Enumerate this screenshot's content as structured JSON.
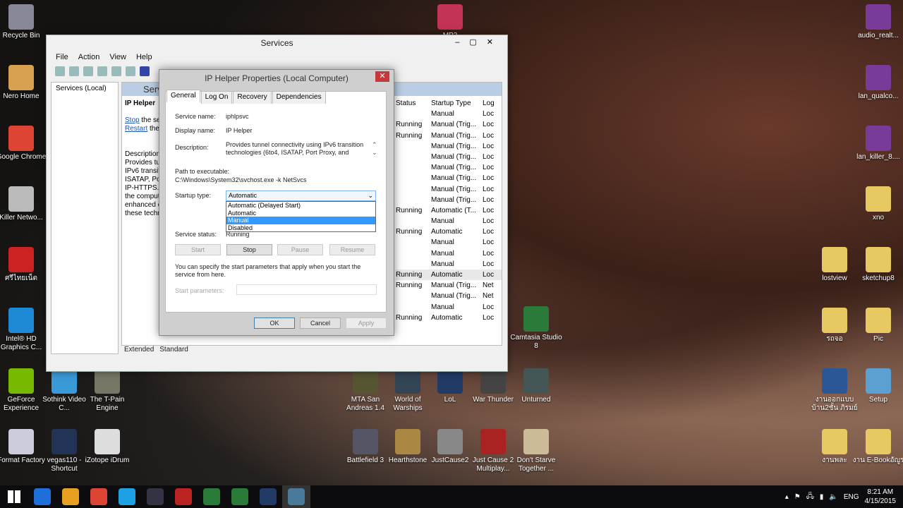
{
  "desktop": {
    "icons": [
      {
        "label": "Recycle Bin",
        "color": "#889"
      },
      {
        "label": "Nero Home",
        "color": "#d9a050"
      },
      {
        "label": "Google Chrome",
        "color": "#dd4433"
      },
      {
        "label": "Killer Netwo...",
        "color": "#bbb"
      },
      {
        "label": "ศรีไทยเน็ต",
        "color": "#c22"
      },
      {
        "label": "Intel® HD Graphics C...",
        "color": "#1e8ad6"
      },
      {
        "label": "GeForce Experience",
        "color": "#76b900"
      },
      {
        "label": "Sothink Video C...",
        "color": "#3a9ad8"
      },
      {
        "label": "The T-Pain Engine",
        "color": "#776"
      },
      {
        "label": "Format Factory",
        "color": "#ccd"
      },
      {
        "label": "vegas110 - Shortcut",
        "color": "#235"
      },
      {
        "label": "iZotope iDrum",
        "color": "#ddd"
      },
      {
        "label": "MP3",
        "color": "#c23355"
      },
      {
        "label": "Camtasia Studio 8",
        "color": "#2a7a3a"
      },
      {
        "label": "MTA San Andreas 1.4",
        "color": "#553"
      },
      {
        "label": "World of Warships",
        "color": "#345"
      },
      {
        "label": "LoL",
        "color": "#223a66"
      },
      {
        "label": "War Thunder",
        "color": "#444"
      },
      {
        "label": "Unturned",
        "color": "#455"
      },
      {
        "label": "Battlefield 3",
        "color": "#556"
      },
      {
        "label": "Hearthstone",
        "color": "#a84"
      },
      {
        "label": "JustCause2",
        "color": "#888"
      },
      {
        "label": "Just Cause 2 Multiplay...",
        "color": "#a22"
      },
      {
        "label": "Don't Starve Together ...",
        "color": "#cb9"
      },
      {
        "label": "audio_realt...",
        "color": "#7a3a9a"
      },
      {
        "label": "lan_qualco...",
        "color": "#7a3a9a"
      },
      {
        "label": "lan_killer_8....",
        "color": "#7a3a9a"
      },
      {
        "label": "xno",
        "color": "#e8c860"
      },
      {
        "label": "lostview",
        "color": "#e8c860"
      },
      {
        "label": "sketchup8",
        "color": "#e8c860"
      },
      {
        "label": "รถจอ",
        "color": "#e8c860"
      },
      {
        "label": "Pic",
        "color": "#e8c860"
      },
      {
        "label": "งานออกแบบ บ้าน2ชั้น ภิรมย์",
        "color": "#2b5797"
      },
      {
        "label": "Setup",
        "color": "#5aa0d0"
      },
      {
        "label": "งานพละ",
        "color": "#e8c860"
      },
      {
        "label": "งาน E-Bookอัญูร",
        "color": "#e8c860"
      }
    ]
  },
  "services": {
    "title": "Services",
    "menu": [
      "File",
      "Action",
      "View",
      "Help"
    ],
    "tree_item": "Services (Local)",
    "header": "Services",
    "selected_name": "IP Helper",
    "stop_link": "Stop",
    "stop_rest": " the service",
    "restart_link": "Restart",
    "restart_rest": " the service",
    "description_lines": [
      "Description:",
      "Provides tunnel connectivity using",
      "IPv6 transition technologies (6to4,",
      "ISATAP, Port Proxy, and Teredo), and",
      "IP-HTTPS. If this service is stopped,",
      "the computer will not have the",
      "enhanced connectivity benefits that",
      "these technologies offer."
    ],
    "columns": [
      "Status",
      "Startup Type",
      "Log"
    ],
    "rows": [
      [
        "",
        "Manual",
        "Loc"
      ],
      [
        "Running",
        "Manual (Trig...",
        "Loc"
      ],
      [
        "Running",
        "Manual (Trig...",
        "Loc"
      ],
      [
        "",
        "Manual (Trig...",
        "Loc"
      ],
      [
        "",
        "Manual (Trig...",
        "Loc"
      ],
      [
        "",
        "Manual (Trig...",
        "Loc"
      ],
      [
        "",
        "Manual (Trig...",
        "Loc"
      ],
      [
        "",
        "Manual (Trig...",
        "Loc"
      ],
      [
        "",
        "Manual (Trig...",
        "Loc"
      ],
      [
        "Running",
        "Automatic (T...",
        "Loc"
      ],
      [
        "",
        "Manual",
        "Loc"
      ],
      [
        "Running",
        "Automatic",
        "Loc"
      ],
      [
        "",
        "Manual",
        "Loc"
      ],
      [
        "",
        "Manual",
        "Loc"
      ],
      [
        "",
        "Manual",
        "Loc"
      ],
      [
        "Running",
        "Automatic",
        "Loc"
      ],
      [
        "Running",
        "Manual (Trig...",
        "Net"
      ],
      [
        "",
        "Manual (Trig...",
        "Net"
      ],
      [
        "",
        "Manual",
        "Loc"
      ],
      [
        "Running",
        "Automatic",
        "Loc"
      ]
    ],
    "tabs": [
      "Extended",
      "Standard"
    ]
  },
  "dialog": {
    "title": "IP Helper Properties (Local Computer)",
    "close": "✕",
    "tabs": [
      "General",
      "Log On",
      "Recovery",
      "Dependencies"
    ],
    "service_name_label": "Service name:",
    "service_name": "iphlpsvc",
    "display_name_label": "Display name:",
    "display_name": "IP Helper",
    "description_label": "Description:",
    "description": "Provides tunnel connectivity using IPv6 transition technologies (6to4, ISATAP, Port Proxy, and",
    "path_label": "Path to executable:",
    "path": "C:\\Windows\\System32\\svchost.exe -k NetSvcs",
    "startup_label": "Startup type:",
    "startup_value": "Automatic",
    "startup_options": [
      "Automatic (Delayed Start)",
      "Automatic",
      "Manual",
      "Disabled"
    ],
    "highlighted_option": "Manual",
    "status_label": "Service status:",
    "status": "Running",
    "buttons": {
      "start": "Start",
      "stop": "Stop",
      "pause": "Pause",
      "resume": "Resume",
      "ok": "OK",
      "cancel": "Cancel",
      "apply": "Apply"
    },
    "hint": "You can specify the start parameters that apply when you start the service from here.",
    "params_label": "Start parameters:",
    "params_value": ""
  },
  "taskbar": {
    "lang": "ENG",
    "time": "8:21 AM",
    "date": "4/15/2015",
    "apps": [
      "#1e6fd9",
      "#e8a020",
      "#dd4433",
      "#1da1e2",
      "#334",
      "#b22",
      "#2a7a3a",
      "#2a7a3a",
      "#223a66",
      "#4a7a9a"
    ]
  }
}
